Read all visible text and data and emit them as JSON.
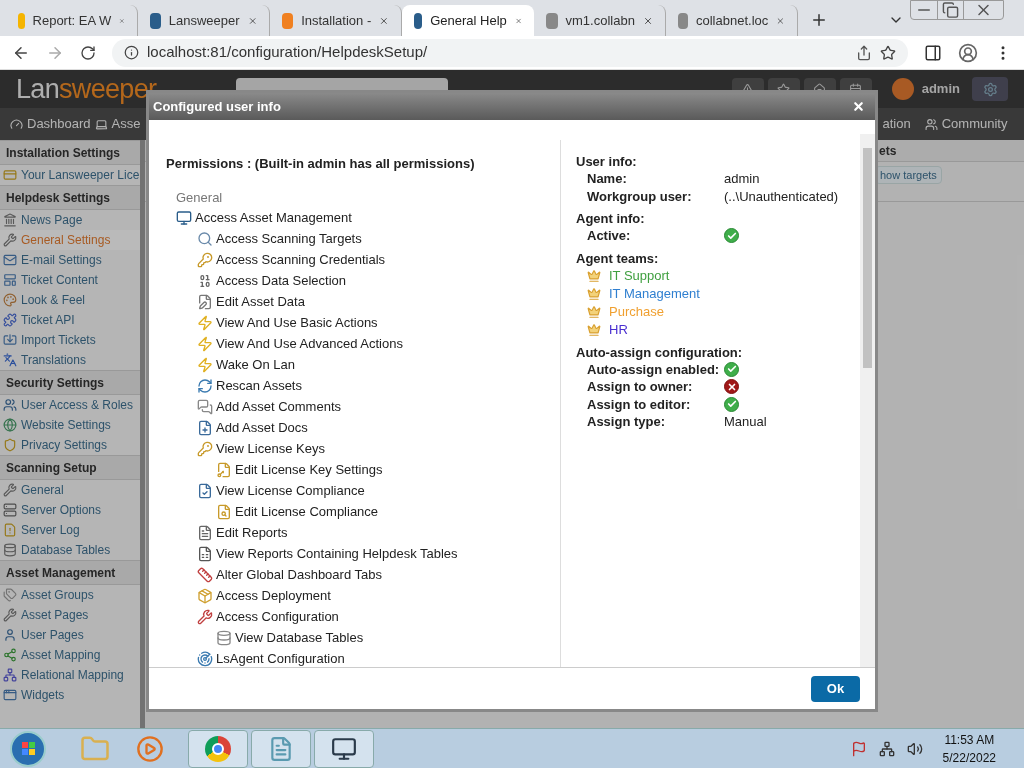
{
  "browser": {
    "tabs": [
      {
        "title": "Report: EA W",
        "selected": false
      },
      {
        "title": "Lansweeper",
        "selected": false
      },
      {
        "title": "Installation -",
        "selected": false
      },
      {
        "title": "General Help",
        "selected": true
      },
      {
        "title": "vm1.collabn",
        "selected": false
      },
      {
        "title": "collabnet.loc",
        "selected": false
      }
    ],
    "url": "localhost:81/configuration/HelpdeskSetup/"
  },
  "app": {
    "logo_start": "Lan",
    "logo_end": "sweeper",
    "user": "admin",
    "nav": [
      {
        "label": "Dashboard"
      },
      {
        "label": "Asse"
      },
      {
        "label": "ation"
      },
      {
        "label": "Community"
      }
    ]
  },
  "sidebar": {
    "sections": [
      {
        "title": "Installation Settings",
        "items": [
          {
            "label": "Your Lansweeper Lice",
            "selected": false
          }
        ]
      },
      {
        "title": "Helpdesk Settings",
        "items": [
          {
            "label": "News Page",
            "selected": false
          },
          {
            "label": "General Settings",
            "selected": true
          },
          {
            "label": "E-mail Settings",
            "selected": false
          },
          {
            "label": "Ticket Content",
            "selected": false
          },
          {
            "label": "Look & Feel",
            "selected": false
          },
          {
            "label": "Ticket API",
            "selected": false
          },
          {
            "label": "Import Tickets",
            "selected": false
          },
          {
            "label": "Translations",
            "selected": false
          }
        ]
      },
      {
        "title": "Security Settings",
        "items": [
          {
            "label": "User Access & Roles",
            "selected": false
          },
          {
            "label": "Website Settings",
            "selected": false
          },
          {
            "label": "Privacy Settings",
            "selected": false
          }
        ]
      },
      {
        "title": "Scanning Setup",
        "items": [
          {
            "label": "General",
            "selected": false
          },
          {
            "label": "Server Options",
            "selected": false
          },
          {
            "label": "Server Log",
            "selected": false
          },
          {
            "label": "Database Tables",
            "selected": false
          }
        ]
      },
      {
        "title": "Asset Management",
        "items": [
          {
            "label": "Asset Groups",
            "selected": false
          },
          {
            "label": "Asset Pages",
            "selected": false
          },
          {
            "label": "User Pages",
            "selected": false
          },
          {
            "label": "Asset Mapping",
            "selected": false
          },
          {
            "label": "Relational Mapping",
            "selected": false
          },
          {
            "label": "Widgets",
            "selected": false
          }
        ]
      }
    ]
  },
  "background_panel": {
    "title": "ets",
    "button": "how targets"
  },
  "dialog": {
    "title": "Configured user info",
    "permissions": {
      "heading": "Permissions : (Built-in admin has all permissions)",
      "group": "General",
      "items": [
        {
          "label": "Access Asset Management",
          "children": [
            {
              "label": "Access Scanning Targets"
            },
            {
              "label": "Access Scanning Credentials"
            },
            {
              "label": "Access Data Selection"
            },
            {
              "label": "Edit Asset Data"
            },
            {
              "label": "View And Use Basic Actions"
            },
            {
              "label": "View And Use Advanced Actions"
            },
            {
              "label": "Wake On Lan"
            },
            {
              "label": "Rescan Assets"
            },
            {
              "label": "Add Asset Comments"
            },
            {
              "label": "Add Asset Docs"
            },
            {
              "label": "View License Keys",
              "children": [
                {
                  "label": "Edit License Key Settings"
                }
              ]
            },
            {
              "label": "View License Compliance",
              "children": [
                {
                  "label": "Edit License Compliance"
                }
              ]
            },
            {
              "label": "Edit Reports"
            },
            {
              "label": "View Reports Containing Helpdesk Tables"
            },
            {
              "label": "Alter Global Dashboard Tabs"
            },
            {
              "label": "Access Deployment"
            },
            {
              "label": "Access Configuration",
              "children": [
                {
                  "label": "View Database Tables"
                }
              ]
            },
            {
              "label": "LsAgent Configuration"
            }
          ]
        }
      ]
    },
    "sections": [
      {
        "heading": "User info:",
        "fields": [
          {
            "label": "Name:",
            "kind": "text",
            "value": "admin"
          },
          {
            "label": "Workgroup user:",
            "kind": "text",
            "value": "(..\\Unauthenticated)"
          }
        ]
      },
      {
        "heading": "Agent info:",
        "fields": [
          {
            "label": "Active:",
            "kind": "status",
            "on": true
          }
        ]
      },
      {
        "heading": "Agent teams:",
        "teams": [
          {
            "name": "IT Support",
            "color": "#3f9f3f"
          },
          {
            "name": "IT Management",
            "color": "#2f7fd0"
          },
          {
            "name": "Purchase",
            "color": "#f0a030"
          },
          {
            "name": "HR",
            "color": "#4a2fd0"
          }
        ]
      },
      {
        "heading": "Auto-assign configuration:",
        "fields": [
          {
            "label": "Auto-assign enabled:",
            "kind": "status",
            "on": true
          },
          {
            "label": "Assign to owner:",
            "kind": "status",
            "on": false
          },
          {
            "label": "Assign to editor:",
            "kind": "status",
            "on": true
          },
          {
            "label": "Assign type:",
            "kind": "text",
            "value": "Manual"
          }
        ]
      }
    ],
    "ok_button": "Ok"
  },
  "taskbar": {
    "time": "11:53 AM",
    "date": "5/22/2022"
  }
}
